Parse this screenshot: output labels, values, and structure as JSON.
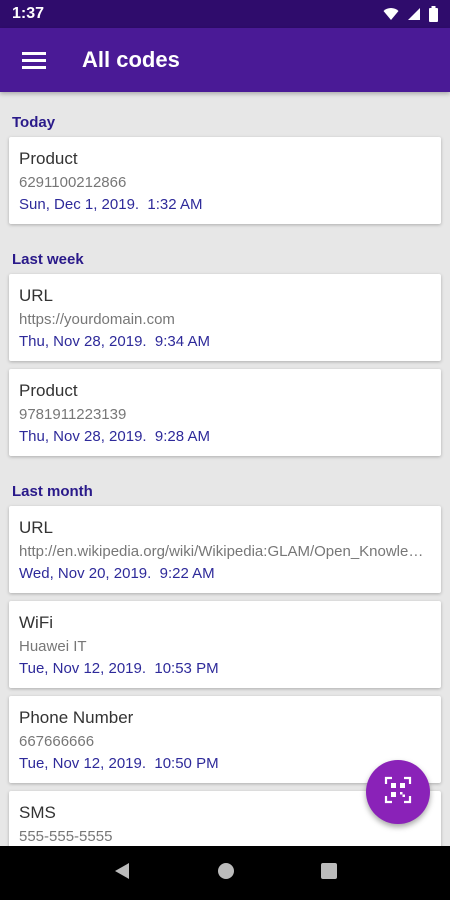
{
  "status_bar": {
    "time": "1:37",
    "icons": [
      "wifi-icon",
      "signal-icon",
      "battery-icon"
    ]
  },
  "app_bar": {
    "title": "All codes",
    "menu_icon": "hamburger-menu-icon"
  },
  "sections": [
    {
      "title": "Today",
      "items": [
        {
          "type": "Product",
          "value": "6291100212866",
          "date": "Sun, Dec 1, 2019.  1:32 AM"
        }
      ]
    },
    {
      "title": "Last week",
      "items": [
        {
          "type": "URL",
          "value": "https://yourdomain.com",
          "date": "Thu, Nov 28, 2019.  9:34 AM"
        },
        {
          "type": "Product",
          "value": "9781911223139",
          "date": "Thu, Nov 28, 2019.  9:28 AM"
        }
      ]
    },
    {
      "title": "Last month",
      "items": [
        {
          "type": "URL",
          "value": "http://en.wikipedia.org/wiki/Wikipedia:GLAM/Open_Knowledge",
          "date": "Wed, Nov 20, 2019.  9:22 AM"
        },
        {
          "type": "WiFi",
          "value": "Huawei IT",
          "date": "Tue, Nov 12, 2019.  10:53 PM"
        },
        {
          "type": "Phone Number",
          "value": "667666666",
          "date": "Tue, Nov 12, 2019.  10:50 PM"
        },
        {
          "type": "SMS",
          "value": "555-555-5555",
          "date": ""
        }
      ]
    }
  ],
  "fab": {
    "icon": "qr-scan-icon"
  },
  "nav_bar": {
    "icons": [
      "back-icon",
      "home-icon",
      "recents-icon"
    ]
  },
  "colors": {
    "status_bar": "#2f0c6c",
    "app_bar": "#4a1a96",
    "accent_text": "#2e2a9a",
    "fab": "#8a22b8",
    "background": "#e7e7e7"
  }
}
